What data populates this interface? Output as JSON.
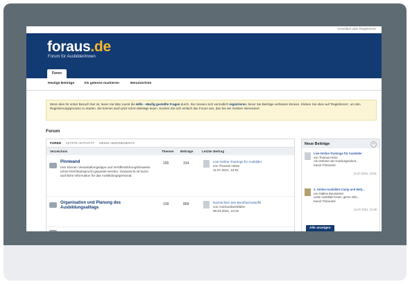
{
  "topbar": {
    "login": "Anmelden oder Registrieren"
  },
  "header": {
    "logo_main": "foraus",
    "logo_suffix": ".de",
    "tagline": "Forum für Ausbilder/innen"
  },
  "nav": {
    "tab": "Foren"
  },
  "subnav": [
    "Heutige Beiträge",
    "Als gelesen markieren",
    "Benutzerliste"
  ],
  "notice": {
    "part1": "Wenn dies Ihr erster Besuch hier ist, lesen Sie bitte zuerst die ",
    "link1": "Hilfe - Häufig gestellte Fragen",
    "part2": " durch. Sie müssen sich vermutlich ",
    "link2": "registrieren",
    "part3": ", bevor Sie Beiträge verfassen können. Klicken Sie oben auf 'Registrieren', um den Registrierungsprozess zu starten. Sie können auch jetzt schon Beiträge lesen. Suchen Sie sich einfach das Forum aus, das Sie am meisten interessiert."
  },
  "forum_heading": "Forum",
  "panel": {
    "tabs": [
      "FOREN",
      "LETZTE AKTIVITÄT",
      "MEINE ABONNEMENTS"
    ],
    "headers": {
      "dir": "Verzeichnis",
      "threads": "Themen",
      "posts": "Beiträge",
      "last": "Letzter Beitrag"
    },
    "rows": [
      {
        "title": "Pinnwand",
        "desc": "Hier können Veranstaltungstipps und Veröffentlichungshinweise (ohne Rechtsanspruch) gepostet werden. Gewünscht ist kurze sachliche Information für das Ausbildungspersonal.",
        "threads": "155",
        "posts": "314",
        "last_title": "Live-Online-Trainings für Ausbilder",
        "last_by": "von Thomas Heise",
        "last_date": "11.07.2021, 13:51"
      },
      {
        "title": "Organisation und Planung des Ausbildungsalltags",
        "desc": "",
        "threads": "139",
        "posts": "809",
        "last_title": "Nachrichten des Berufsschulstoffs",
        "last_by": "von AusSuedwestfalen",
        "last_date": "06.04.2021, 10:15"
      }
    ]
  },
  "side": {
    "title": "Neue Beiträge",
    "items": [
      {
        "title": "Live-Online-Trainings für Ausbilder",
        "by": "von Thomas Heise",
        "desc": "Als Vertreter der Handungsorient...",
        "channel": "Kanal: Pinnwand",
        "date": "11.07.2021, 13:51"
      },
      {
        "title": "2. Online-Ausbilder-Camp und Web...",
        "by": "von Sabine Baumeister",
        "desc": "Liebe Ausbilder*innen, gerne infor...",
        "channel": "Kanal: Pinnwand",
        "date": "11.07.2021, 11:38"
      }
    ],
    "button": "Alle anzeigen"
  }
}
